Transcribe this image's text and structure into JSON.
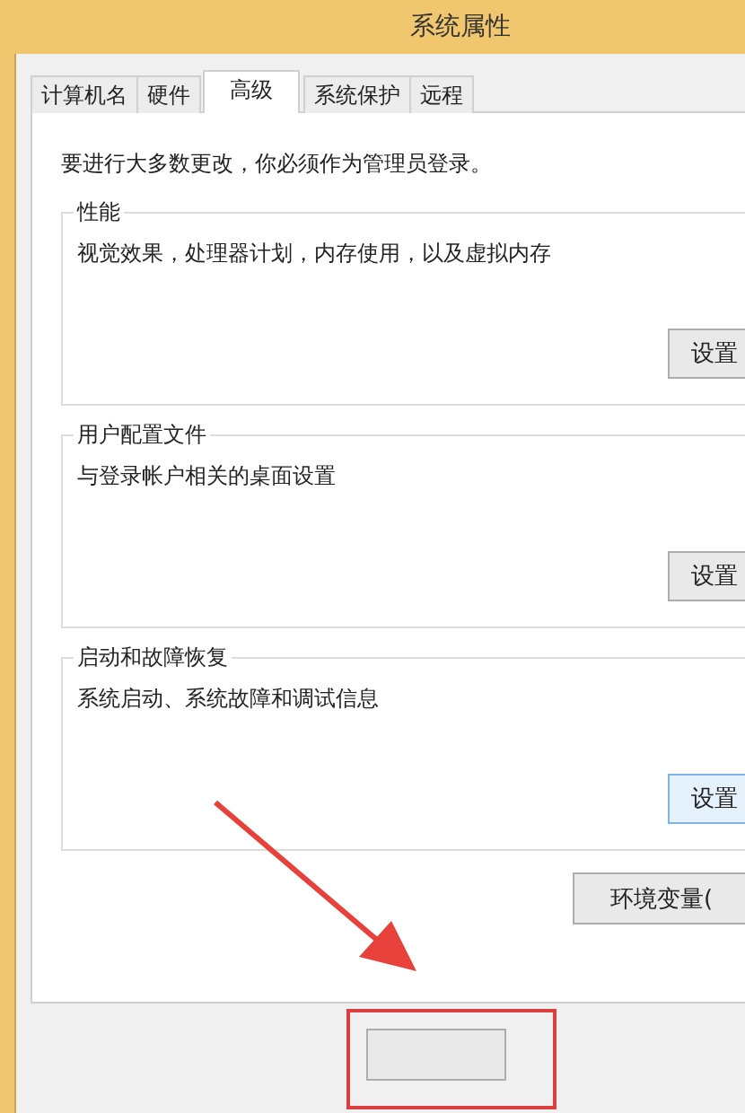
{
  "window": {
    "title": "系统属性"
  },
  "tabs": [
    {
      "label": "计算机名",
      "selected": false
    },
    {
      "label": "硬件",
      "selected": false
    },
    {
      "label": "高级",
      "selected": true
    },
    {
      "label": "系统保护",
      "selected": false
    },
    {
      "label": "远程",
      "selected": false
    }
  ],
  "notice": "要进行大多数更改，你必须作为管理员登录。",
  "groups": [
    {
      "title": "性能",
      "description": "视觉效果，处理器计划，内存使用，以及虚拟内存",
      "button": "设置",
      "focused": false
    },
    {
      "title": "用户配置文件",
      "description": "与登录帐户相关的桌面设置",
      "button": "设置",
      "focused": false
    },
    {
      "title": "启动和故障恢复",
      "description": "系统启动、系统故障和调试信息",
      "button": "设置",
      "focused": true
    }
  ],
  "env_button": "环境变量(",
  "annotations": {
    "arrow": true,
    "highlight_box": true
  }
}
